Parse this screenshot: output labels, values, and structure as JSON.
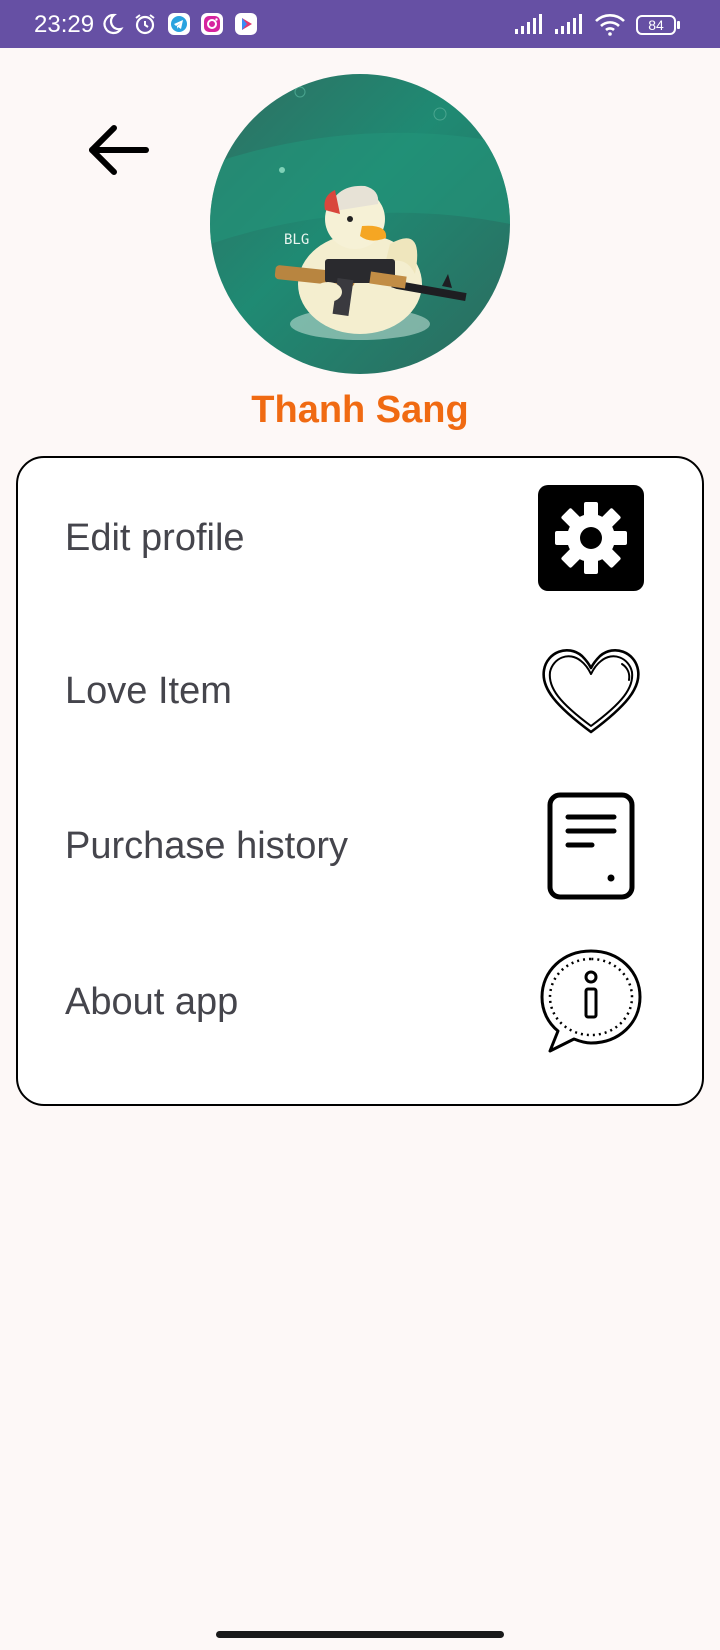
{
  "status_bar": {
    "time": "23:29",
    "battery": "84",
    "background": "#6650a4",
    "icons": [
      "moon-icon",
      "alarm-icon",
      "telegram-icon",
      "instagram-icon",
      "play-store-icon",
      "signal-icon",
      "signal-icon",
      "wifi-icon",
      "battery-icon"
    ]
  },
  "profile": {
    "name": "Thanh Sang",
    "name_color": "#f06a12"
  },
  "menu": {
    "items": [
      {
        "label": "Edit profile",
        "icon": "gear-icon"
      },
      {
        "label": "Love Item",
        "icon": "heart-icon"
      },
      {
        "label": "Purchase history",
        "icon": "document-icon"
      },
      {
        "label": "About app",
        "icon": "info-bubble-icon"
      }
    ]
  }
}
